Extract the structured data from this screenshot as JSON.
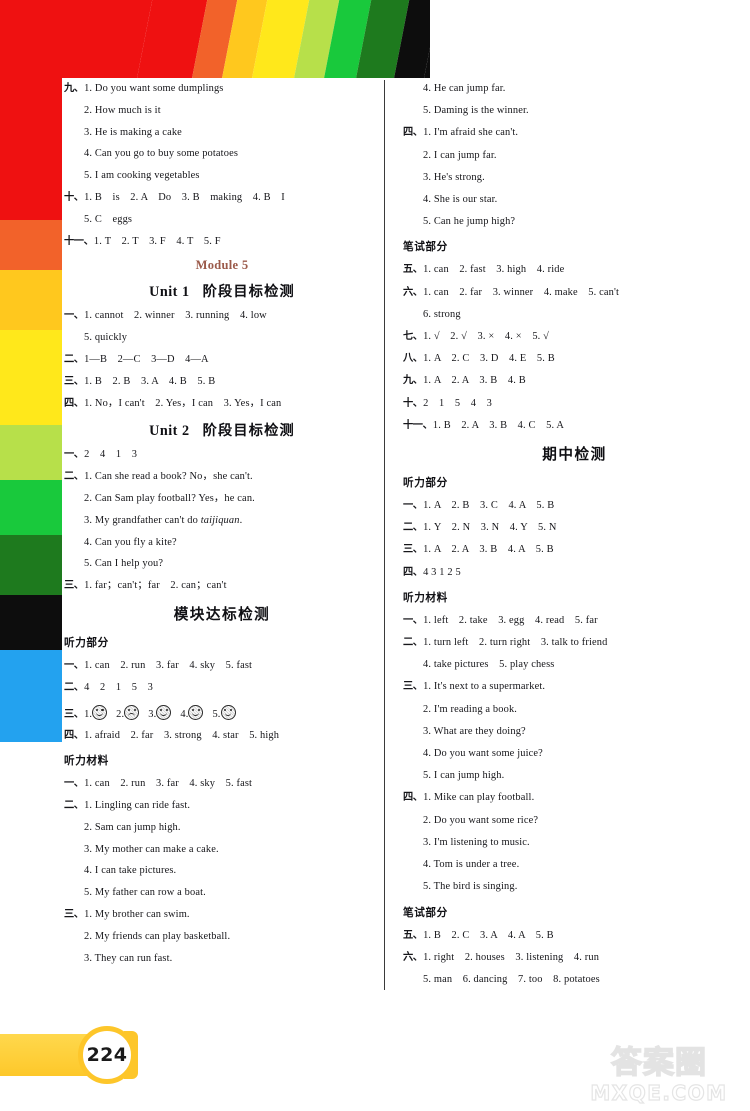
{
  "page": {
    "number": "224"
  },
  "watermark": {
    "cn": "答案圈",
    "en": "MXQE.COM",
    "ghost": "答案"
  },
  "decor": {
    "rainbow_colors": [
      "#ef1111",
      "#ef1111",
      "#f2622a",
      "#ffc81e",
      "#ffe81b",
      "#b7e04a",
      "#19c93c",
      "#1e7a1e",
      "#0d0d0d",
      "#23a2ef",
      "#1a2fa0"
    ],
    "left_strip_colors": [
      "#ef1111",
      "#ef1111",
      "#f2622a",
      "#ffc81e",
      "#ffe81b",
      "#b7e04a",
      "#19c93c",
      "#1e7a1e",
      "#0d0d0d",
      "#23a2ef"
    ],
    "module_color": "#9b5a4a",
    "banner_color": "#fdc62a"
  },
  "left_column": {
    "block_jiu": {
      "marker": "九、",
      "items": [
        "1. Do you want some dumplings",
        "2. How much is it",
        "3. He is making a cake",
        "4. Can you go to buy some potatoes",
        "5. I am cooking vegetables"
      ]
    },
    "block_shi": {
      "marker": "十、",
      "line1": "1. B　is　2. A　Do　3. B　making　4. B　I",
      "line2": "5. C　eggs"
    },
    "block_shiyi": {
      "marker": "十一、",
      "line1": "1. T　2. T　3. F　4. T　5. F"
    },
    "module_title": "Module 5",
    "unit1": {
      "title_en": "Unit 1",
      "title_cn": "阶段目标检测",
      "rows": [
        {
          "marker": "一、",
          "text": "1. cannot　2. winner　3. running　4. low"
        },
        {
          "marker": "",
          "text": "5. quickly"
        },
        {
          "marker": "二、",
          "text": "1—B　2—C　3—D　4—A"
        },
        {
          "marker": "三、",
          "text": "1. B　2. B　3. A　4. B　5. B"
        },
        {
          "marker": "四、",
          "text": "1. No，I can't　2. Yes，I can　3. Yes，I can"
        }
      ]
    },
    "unit2": {
      "title_en": "Unit 2",
      "title_cn": "阶段目标检测",
      "rows": [
        {
          "marker": "一、",
          "text": "2　4　1　3"
        },
        {
          "marker": "二、",
          "text": "1. Can she read a book? No，she can't."
        },
        {
          "marker": "",
          "text": "2. Can Sam play football?  Yes，he can."
        },
        {
          "marker": "",
          "text": "3. My grandfather can't do taijiquan.",
          "italic_tail": "taijiquan."
        },
        {
          "marker": "",
          "text": "4. Can you fly a kite?"
        },
        {
          "marker": "",
          "text": "5. Can I help you?"
        },
        {
          "marker": "三、",
          "text": "1. far；can't；far　2. can；can't"
        }
      ]
    },
    "module_test": {
      "title": "模块达标检测",
      "listening_head": "听力部分",
      "listening_rows": [
        {
          "marker": "一、",
          "text": "1. can　2. run　3. far　4. sky　5. fast"
        },
        {
          "marker": "二、",
          "text": "4　2　1　5　3"
        }
      ],
      "faces_row": {
        "marker": "三、",
        "faces": [
          {
            "num": "1.",
            "mood": "happy"
          },
          {
            "num": "2.",
            "mood": "sad"
          },
          {
            "num": "3.",
            "mood": "happy"
          },
          {
            "num": "4.",
            "mood": "happy"
          },
          {
            "num": "5.",
            "mood": "happy"
          }
        ]
      },
      "row_si": {
        "marker": "四、",
        "text": "1. afraid　2. far　3. strong　4. star　5. high"
      },
      "material_head": "听力材料",
      "material_rows": [
        {
          "marker": "一、",
          "text": "1. can　2. run　3. far　4. sky　5. fast"
        },
        {
          "marker": "二、",
          "text": "1. Lingling can ride fast."
        },
        {
          "marker": "",
          "text": "2. Sam can jump high."
        },
        {
          "marker": "",
          "text": "3. My mother can make a cake."
        },
        {
          "marker": "",
          "text": "4. I can take pictures."
        },
        {
          "marker": "",
          "text": "5. My father can row a boat."
        },
        {
          "marker": "三、",
          "text": "1. My brother can swim."
        },
        {
          "marker": "",
          "text": "2. My friends can play basketball."
        },
        {
          "marker": "",
          "text": "3. They can run fast."
        }
      ]
    }
  },
  "right_column": {
    "cont_rows": [
      {
        "marker": "",
        "text": "4. He can jump far."
      },
      {
        "marker": "",
        "text": "5. Daming is the winner."
      },
      {
        "marker": "四、",
        "text": "1. I'm afraid she can't."
      },
      {
        "marker": "",
        "text": "2. I can jump far."
      },
      {
        "marker": "",
        "text": "3. He's strong."
      },
      {
        "marker": "",
        "text": "4. She is our star."
      },
      {
        "marker": "",
        "text": "5. Can he jump high?"
      }
    ],
    "written_head": "笔试部分",
    "written_rows": [
      {
        "marker": "五、",
        "text": "1. can　2. fast　3. high　4. ride"
      },
      {
        "marker": "六、",
        "text": "1. can　2. far　3. winner　4. make　5. can't"
      },
      {
        "marker": "",
        "text": "6. strong"
      },
      {
        "marker": "七、",
        "text": "1. √　2. √　3. ×　4. ×　5. √"
      },
      {
        "marker": "八、",
        "text": "1. A　2. C　3. D　4. E　5. B"
      },
      {
        "marker": "九、",
        "text": "1. A　2. A　3. B　4. B"
      },
      {
        "marker": "十、",
        "text": "2　1　5　4　3"
      },
      {
        "marker": "十一、",
        "text": "1. B　2. A　3. B　4. C　5. A"
      }
    ],
    "midterm": {
      "title": "期中检测",
      "listening_head": "听力部分",
      "listening_rows": [
        {
          "marker": "一、",
          "text": "1. A　2. B　3. C　4. A　5. B"
        },
        {
          "marker": "二、",
          "text": "1. Y　2. N　3. N　4. Y　5. N"
        },
        {
          "marker": "三、",
          "text": "1. A　2. A　3. B　4. A　5. B"
        },
        {
          "marker": "四、",
          "text": "4 3 1 2 5"
        }
      ],
      "material_head": "听力材料",
      "material_rows": [
        {
          "marker": "一、",
          "text": "1. left　2. take　3. egg　4. read　5. far"
        },
        {
          "marker": "二、",
          "text": "1. turn left　2. turn right　3. talk to friend"
        },
        {
          "marker": "",
          "text": "4. take pictures　5. play chess"
        },
        {
          "marker": "三、",
          "text": "1. It's next to a supermarket."
        },
        {
          "marker": "",
          "text": "2. I'm reading a book."
        },
        {
          "marker": "",
          "text": "3. What are they doing?"
        },
        {
          "marker": "",
          "text": "4. Do you want some juice?"
        },
        {
          "marker": "",
          "text": "5. I can jump high."
        },
        {
          "marker": "四、",
          "text": "1. Mike can play football."
        },
        {
          "marker": "",
          "text": "2. Do you want some rice?"
        },
        {
          "marker": "",
          "text": "3. I'm listening to music."
        },
        {
          "marker": "",
          "text": "4. Tom is under a tree."
        },
        {
          "marker": "",
          "text": "5. The bird is singing."
        }
      ],
      "written_head": "笔试部分",
      "written_rows": [
        {
          "marker": "五、",
          "text": "1. B　2. C　3. A　4. A　5. B"
        },
        {
          "marker": "六、",
          "text": "1. right　2. houses　3. listening　4. run"
        },
        {
          "marker": "",
          "text": "5. man　6. dancing　7. too　8. potatoes"
        }
      ]
    }
  }
}
